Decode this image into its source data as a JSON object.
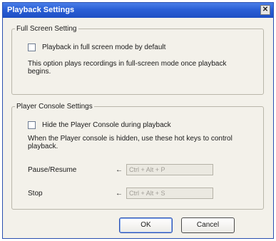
{
  "window": {
    "title": "Playback Settings",
    "close_glyph": "✕"
  },
  "full_screen": {
    "legend": "Full Screen Setting",
    "checkbox_label": "Playback in full screen mode by default",
    "checkbox_checked": false,
    "description": "This option plays recordings in full-screen mode once playback begins."
  },
  "player_console": {
    "legend": "Player Console Settings",
    "checkbox_label": "Hide the Player Console during playback",
    "checkbox_checked": false,
    "description": "When the Player console is hidden, use these hot keys to control playback.",
    "hotkeys": [
      {
        "label": "Pause/Resume",
        "arrow": "←",
        "value": "Ctrl + Alt + P"
      },
      {
        "label": "Stop",
        "arrow": "←",
        "value": "Ctrl + Alt + S"
      }
    ]
  },
  "buttons": {
    "ok": "OK",
    "cancel": "Cancel"
  }
}
